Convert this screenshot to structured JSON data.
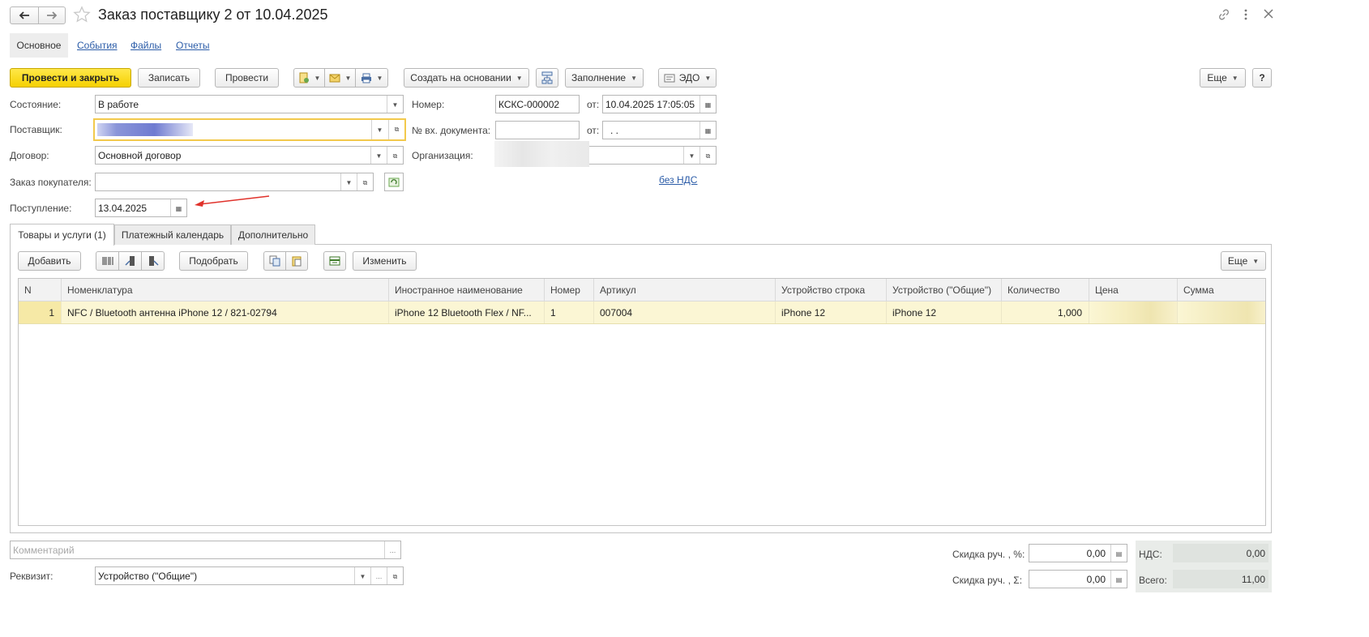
{
  "window": {
    "title": "Заказ поставщику 2 от 10.04.2025",
    "back_icon": "arrow-left-icon",
    "forward_icon": "arrow-right-icon",
    "favorite_icon": "star-icon"
  },
  "nav_tabs": [
    {
      "label": "Основное",
      "active": true
    },
    {
      "label": "События"
    },
    {
      "label": "Файлы"
    },
    {
      "label": "Отчеты"
    }
  ],
  "toolbar": {
    "post_close": "Провести и закрыть",
    "save": "Записать",
    "post": "Провести",
    "create_based": "Создать на основании",
    "fill": "Заполнение",
    "edo": "ЭДО",
    "more": "Еще",
    "help": "?"
  },
  "form": {
    "state_label": "Состояние:",
    "state_value": "В работе",
    "supplier_label": "Поставщик:",
    "contract_label": "Договор:",
    "contract_value": "Основной договор",
    "customer_order_label": "Заказ покупателя:",
    "receipt_label": "Поступление:",
    "receipt_value": "13.04.2025",
    "number_label": "Номер:",
    "number_value": "КСКС-000002",
    "from_label": "от:",
    "date_value": "10.04.2025 17:05:05",
    "incoming_doc_label": "№ вх. документа:",
    "incoming_from_label": "от:",
    "incoming_date_value": " .  .",
    "organization_label": "Организация:",
    "vat_link": "без НДС"
  },
  "doc_tabs": [
    {
      "label": "Товары и услуги (1)",
      "active": true
    },
    {
      "label": "Платежный календарь"
    },
    {
      "label": "Дополнительно"
    }
  ],
  "table_toolbar": {
    "add": "Добавить",
    "pick": "Подобрать",
    "change": "Изменить",
    "more": "Еще"
  },
  "table": {
    "columns": [
      "N",
      "Номенклатура",
      "Иностранное наименование",
      "Номер",
      "Артикул",
      "Устройство строка",
      "Устройство (\"Общие\")",
      "Количество",
      "Цена",
      "Сумма"
    ],
    "rows": [
      {
        "n": "1",
        "nomenclature": "NFC / Bluetooth антенна iPhone 12 / 821-02794",
        "foreign_name": "iPhone 12 Bluetooth Flex / NF...",
        "number": "1",
        "article": "007004",
        "device_line": "iPhone 12",
        "device_common": "iPhone 12",
        "quantity": "1,000",
        "price": "",
        "sum": ""
      }
    ]
  },
  "footer": {
    "comment_placeholder": "Комментарий",
    "requisite_label": "Реквизит:",
    "requisite_value": "Устройство (\"Общие\")",
    "discount_pct_label": "Скидка руч. , %:",
    "discount_pct_value": "0,00",
    "discount_sum_label": "Скидка руч. , Σ:",
    "discount_sum_value": "0,00",
    "vat_label": "НДС:",
    "vat_value": "0,00",
    "total_label": "Всего:",
    "total_value": "11,00"
  },
  "colors": {
    "primary_button": "#f5d000",
    "selected_row": "#fbf6d4",
    "link": "#2b5ca8",
    "annotation_arrow": "#e0322b"
  }
}
